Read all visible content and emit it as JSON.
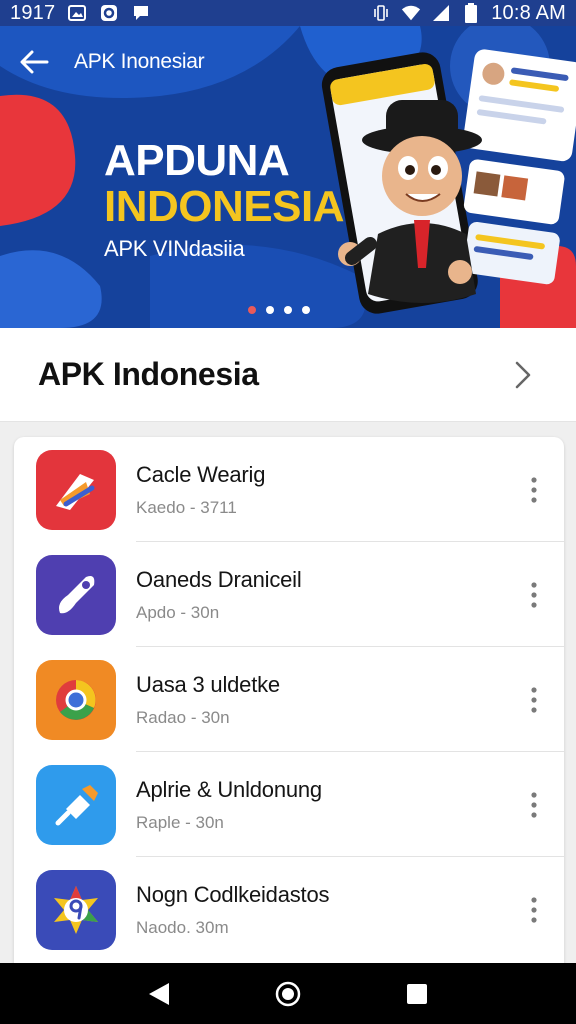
{
  "status_bar": {
    "time_left": "1917",
    "time_right": "10:8 AM",
    "icons": [
      "photo-icon",
      "app-g-icon",
      "chat-icon",
      "vibrate-icon",
      "wifi-icon",
      "signal-icon",
      "battery-icon"
    ]
  },
  "hero": {
    "title": "APK Inonesiar",
    "headline_line1": "APDUNA",
    "headline_line2": "INDONESIA",
    "headline_line3": "APK VINdasiia",
    "dots_count": 4,
    "active_dot": 0
  },
  "section": {
    "title": "APK Indonesia"
  },
  "apps": [
    {
      "name": "Cacle Wearig",
      "meta": "Kaedo - 3711",
      "icon": "red-arrow-app-icon"
    },
    {
      "name": "Oaneds Draniceil",
      "meta": "Apdo - 30n",
      "icon": "rocket-app-icon"
    },
    {
      "name": "Uasa 3 uldetke",
      "meta": "Radao - 30n",
      "icon": "browser-app-icon"
    },
    {
      "name": "Aplrie & Unldonung",
      "meta": "Raple - 30n",
      "icon": "plug-app-icon"
    },
    {
      "name": "Nogn Codlkeidastos",
      "meta": "Naodo. 30m",
      "icon": "number-nine-app-icon"
    }
  ],
  "colors": {
    "hero_blue": "#15429c",
    "accent_yellow": "#f4c51f",
    "accent_red": "#e8363b"
  }
}
